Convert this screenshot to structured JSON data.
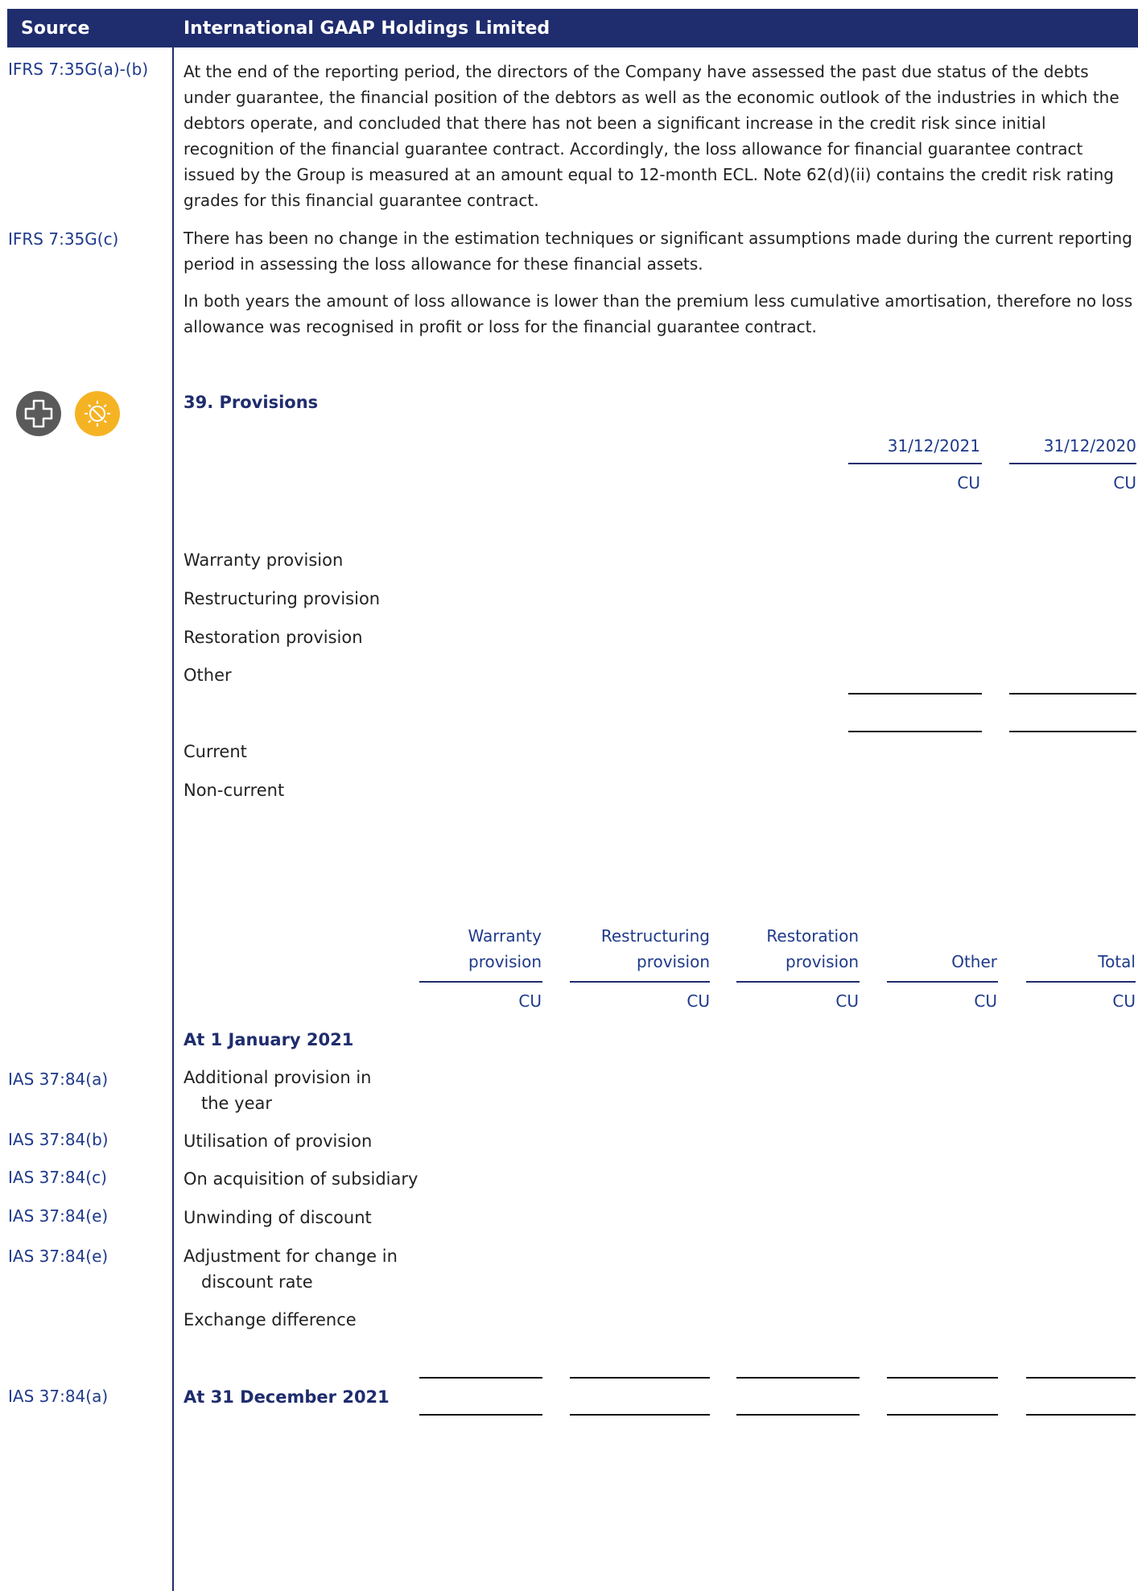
{
  "header": {
    "source_label": "Source",
    "company_label": "International GAAP Holdings Limited"
  },
  "top_section": {
    "rows": [
      {
        "source": "IFRS 7:35G(a)-(b)",
        "text": "At the end of the reporting period, the directors of the Company have assessed the past due status of the debts under guarantee, the financial position of the debtors as well as the economic outlook of the industries in which the debtors operate, and concluded that there has not been a significant increase in the credit risk since initial recognition of the financial guarantee contract. Accordingly, the loss allowance for financial guarantee contract issued by the Group is measured at an amount equal to 12-month ECL. Note 62(d)(ii) contains the credit risk rating grades for this financial guarantee contract."
      },
      {
        "source": "IFRS 7:35G(c)",
        "text": "There has been no change in the estimation techniques or significant assumptions made during the current reporting period in assessing the loss allowance for these financial assets."
      },
      {
        "source": "",
        "text": "In both years the amount of loss allowance is lower than the premium less cumulative amortisation, therefore no loss allowance was recognised in profit or loss for the financial guarantee contract."
      }
    ]
  },
  "icons": [
    {
      "name": "plus-cross-icon",
      "color": "#5a5a5a"
    },
    {
      "name": "sun-no-sign-icon",
      "color": "#f5b324"
    }
  ],
  "note": {
    "title": "39. Provisions"
  },
  "table1": {
    "columns": [
      {
        "date": "31/12/2021",
        "unit": "CU"
      },
      {
        "date": "31/12/2020",
        "unit": "CU"
      }
    ],
    "rows": [
      "Warranty provision",
      "Restructuring provision",
      "Restoration provision",
      "Other"
    ],
    "split_rows": [
      "Current",
      "Non-current"
    ]
  },
  "table2": {
    "columns": [
      {
        "line1": "Warranty",
        "line2": "provision",
        "unit": "CU"
      },
      {
        "line1": "Restructuring",
        "line2": "provision",
        "unit": "CU"
      },
      {
        "line1": "Restoration",
        "line2": "provision",
        "unit": "CU"
      },
      {
        "line1": "",
        "line2": "Other",
        "unit": "CU"
      },
      {
        "line1": "",
        "line2": "Total",
        "unit": "CU"
      }
    ],
    "opening": "At 1 January 2021",
    "rows": [
      {
        "source": "IAS 37:84(a)",
        "line1": "Additional provision in",
        "line2": "the year"
      },
      {
        "source": "IAS 37:84(b)",
        "line1": "Utilisation of provision",
        "line2": ""
      },
      {
        "source": "IAS 37:84(c)",
        "line1": "On acquisition of subsidiary",
        "line2": ""
      },
      {
        "source": "IAS 37:84(e)",
        "line1": "Unwinding of discount",
        "line2": ""
      },
      {
        "source": "IAS 37:84(e)",
        "line1": "Adjustment for change in",
        "line2": "discount rate"
      },
      {
        "source": "",
        "line1": "Exchange difference",
        "line2": ""
      }
    ],
    "closing_source": "IAS 37:84(a)",
    "closing": "At 31 December 2021"
  }
}
